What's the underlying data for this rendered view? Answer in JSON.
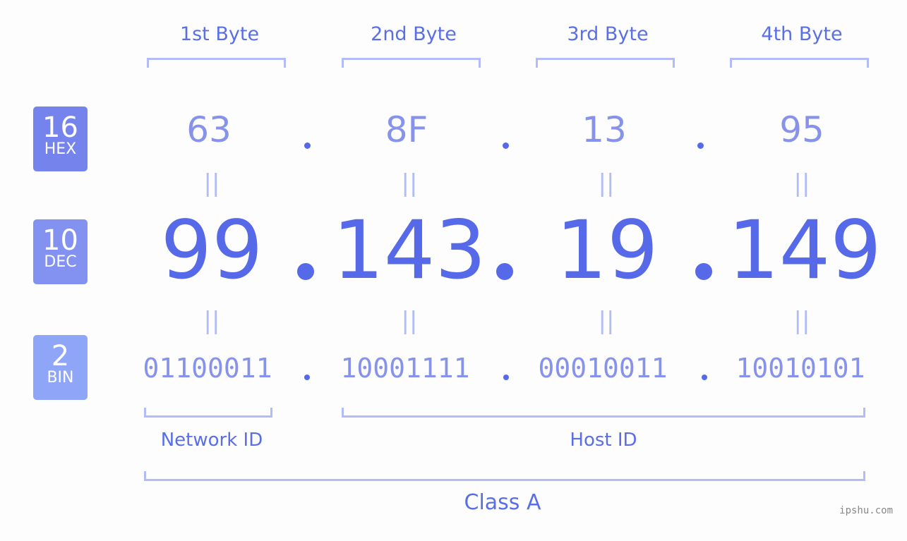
{
  "bytes": [
    {
      "label": "1st Byte",
      "hex": "63",
      "dec": "99",
      "bin": "01100011"
    },
    {
      "label": "2nd Byte",
      "hex": "8F",
      "dec": "143",
      "bin": "10001111"
    },
    {
      "label": "3rd Byte",
      "hex": "13",
      "dec": "19",
      "bin": "00010011"
    },
    {
      "label": "4th Byte",
      "hex": "95",
      "dec": "149",
      "bin": "10010101"
    }
  ],
  "badges": {
    "hex": {
      "base": "16",
      "name": "HEX",
      "color": "#7583ec"
    },
    "dec": {
      "base": "10",
      "name": "DEC",
      "color": "#8392f0"
    },
    "bin": {
      "base": "2",
      "name": "BIN",
      "color": "#8ea5f8"
    }
  },
  "equals": "||",
  "sections": {
    "network": "Network ID",
    "host": "Host ID",
    "class": "Class A"
  },
  "watermark": "ipshu.com",
  "colors": {
    "primary": "#5669e9",
    "secondary": "#8792ea",
    "bracket": "#b3bcf6"
  }
}
